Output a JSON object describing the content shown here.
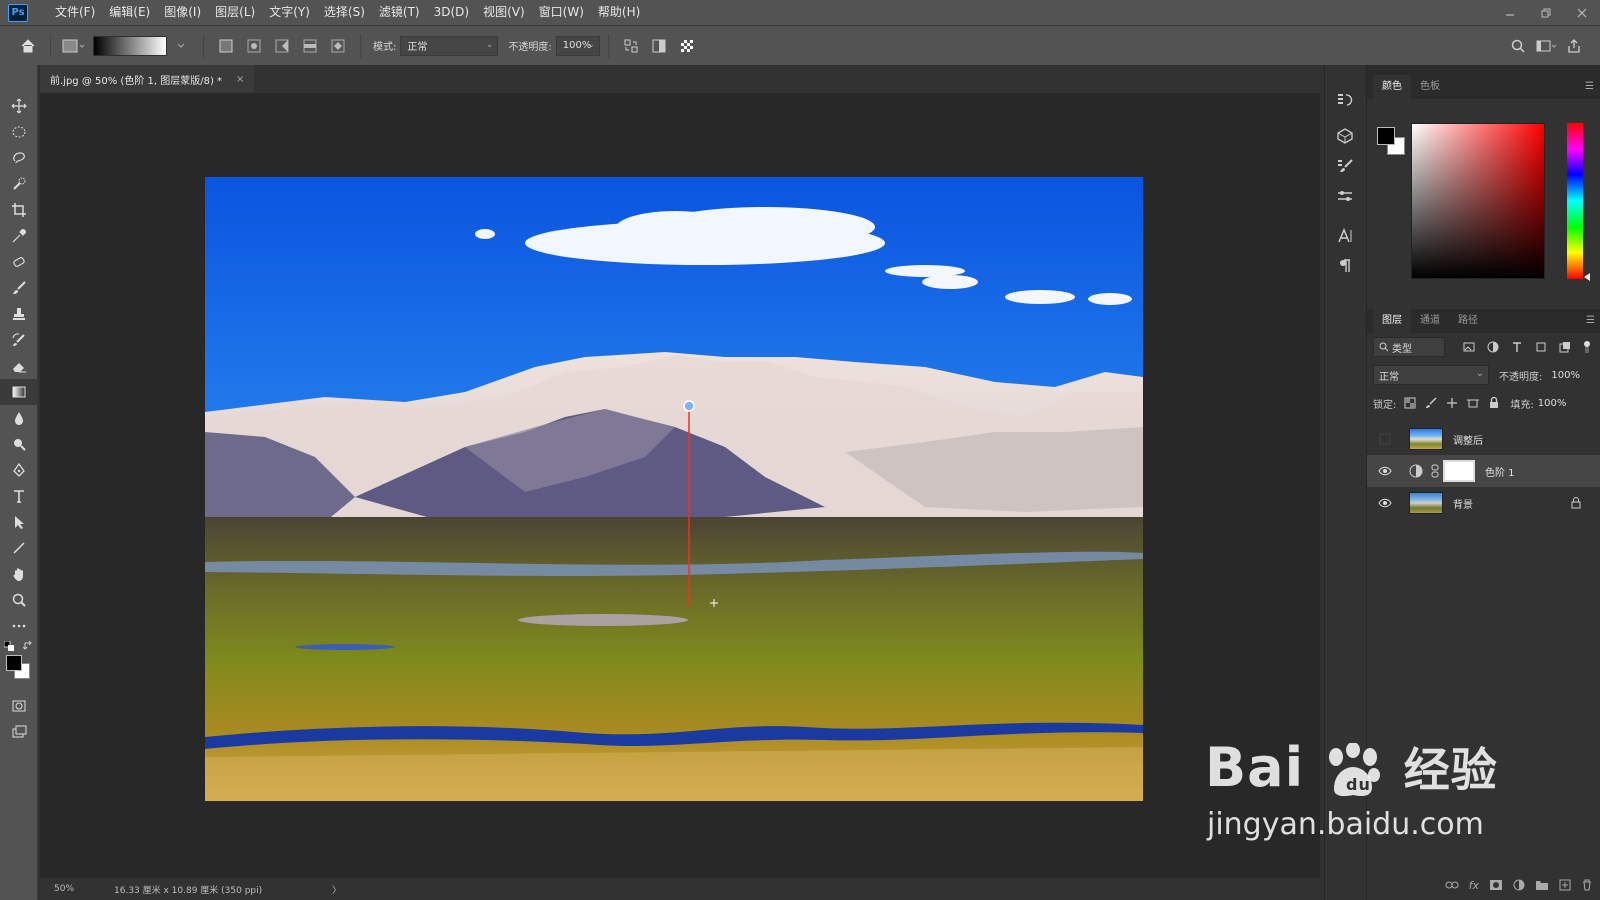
{
  "app": {
    "logo": "Ps",
    "menus": [
      "文件(F)",
      "编辑(E)",
      "图像(I)",
      "图层(L)",
      "文字(Y)",
      "选择(S)",
      "滤镜(T)",
      "3D(D)",
      "视图(V)",
      "窗口(W)",
      "帮助(H)"
    ]
  },
  "options": {
    "mode_label": "模式:",
    "mode_value": "正常",
    "opacity_label": "不透明度:",
    "opacity_value": "100%"
  },
  "document": {
    "tab_title": "前.jpg @ 50% (色阶 1, 图层蒙版/8) *",
    "close_glyph": "×",
    "zoom": "50%",
    "doc_info": "16.33 厘米 x 10.89 厘米 (350 ppi)",
    "arrow": "〉"
  },
  "color_panel": {
    "tabs": [
      "颜色",
      "色板"
    ],
    "foreground": "#000000",
    "background": "#ffffff"
  },
  "layers_panel": {
    "tabs": [
      "图层",
      "通道",
      "路径"
    ],
    "filter_label": "类型",
    "blend_mode": "正常",
    "opacity_label": "不透明度:",
    "opacity_value": "100%",
    "lock_label": "锁定:",
    "fill_label": "填充:",
    "fill_value": "100%",
    "layers": [
      {
        "name": "调整后",
        "visible": false,
        "selected": false
      },
      {
        "name": "色阶 1",
        "visible": true,
        "selected": true
      },
      {
        "name": "背景",
        "visible": true,
        "selected": false,
        "locked": true
      }
    ]
  },
  "watermark": {
    "brand": "Bai",
    "brand_suffix": "经验",
    "url": "jingyan.baidu.com"
  }
}
